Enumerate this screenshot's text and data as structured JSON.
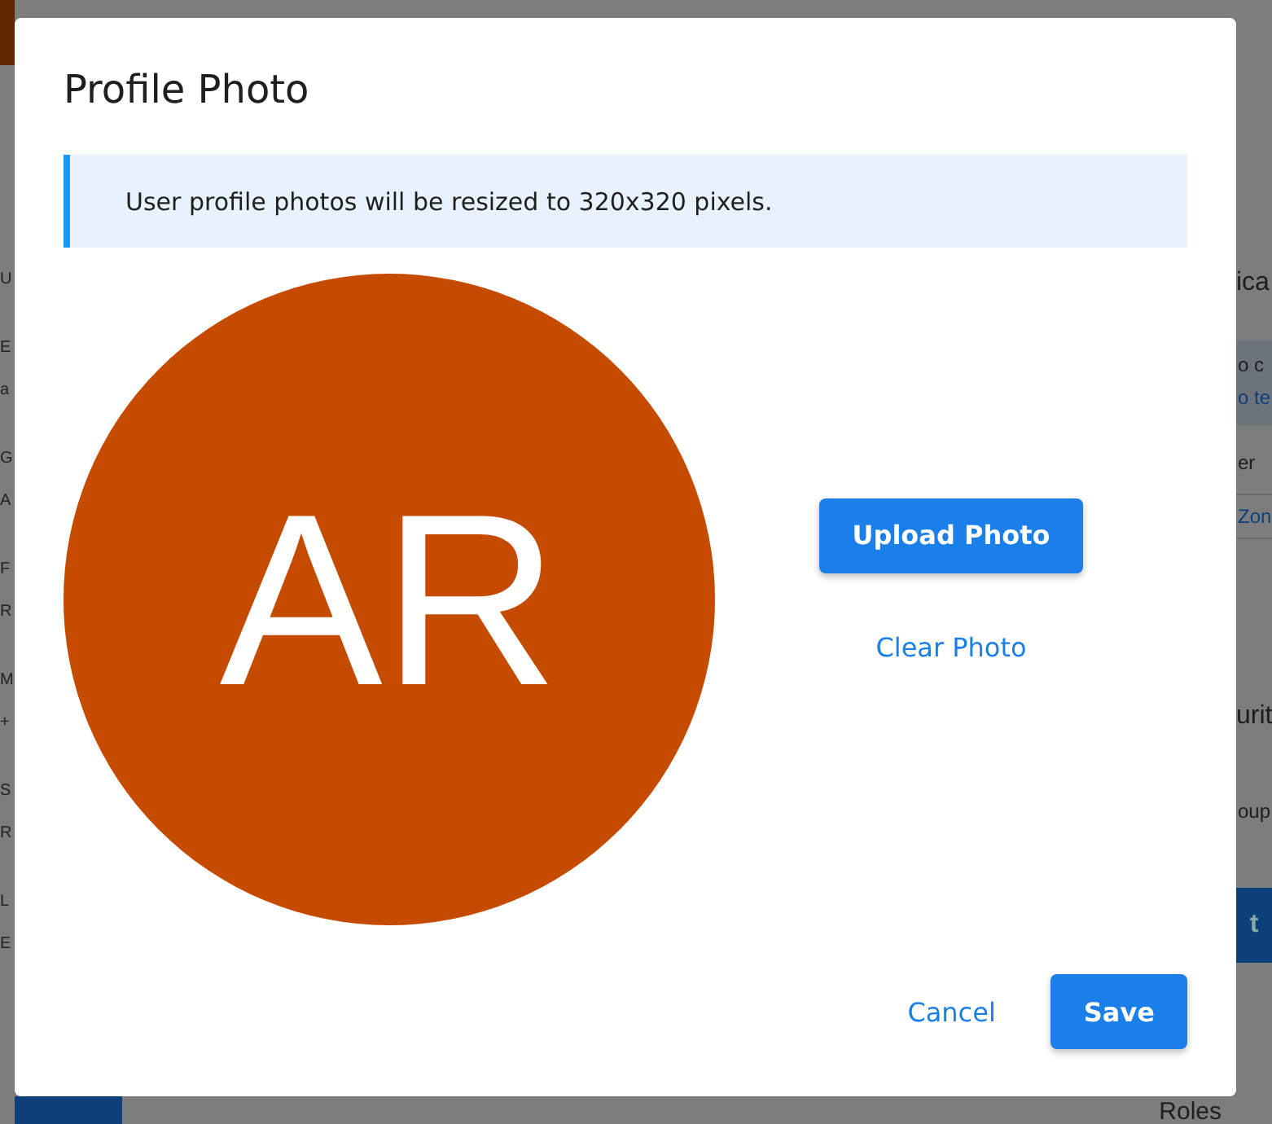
{
  "background": {
    "left_fragments": [
      "U",
      "E",
      "a",
      "G",
      "A",
      "F",
      "R",
      "M",
      "+",
      "S",
      "R",
      "L",
      "E"
    ],
    "right": {
      "heading": "ica",
      "note_lines": [
        "o c",
        "o te"
      ],
      "row_text": "er",
      "link": "Zon",
      "section_heading": "urit",
      "section_text": "oup",
      "button": "t",
      "bottom_heading": "Roles"
    }
  },
  "dialog": {
    "title": "Profile Photo",
    "notice": "User profile photos will be resized to 320x320 pixels.",
    "avatar": {
      "initials": "AR",
      "color": "#c54b00"
    },
    "upload_button": "Upload Photo",
    "clear_link": "Clear Photo",
    "footer": {
      "cancel": "Cancel",
      "save": "Save"
    }
  }
}
